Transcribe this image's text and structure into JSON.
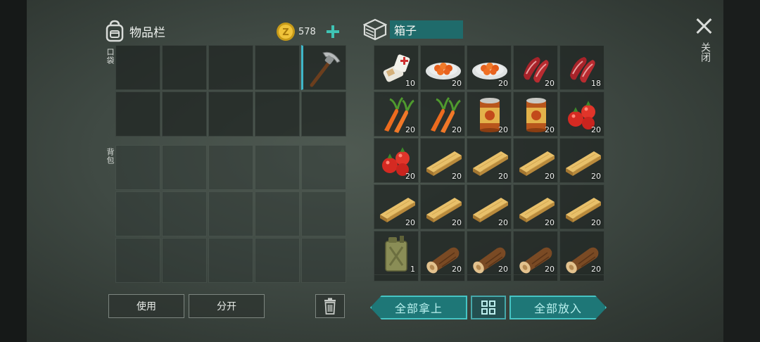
{
  "inventory": {
    "title": "物品栏",
    "coins": "578",
    "pocket_label": "口袋",
    "backpack_label": "背包",
    "use_label": "使用",
    "split_label": "分开",
    "pocket_slot_1_item": "pickaxe-icon"
  },
  "box": {
    "name": "箱子",
    "take_all_label": "全部拿上",
    "put_all_label": "全部放入",
    "slots": [
      {
        "item": "bandage",
        "count": "10"
      },
      {
        "item": "carrot-dish",
        "count": "20"
      },
      {
        "item": "carrot-dish",
        "count": "20"
      },
      {
        "item": "raw-meat",
        "count": "20"
      },
      {
        "item": "raw-meat",
        "count": "18"
      },
      {
        "item": "carrot",
        "count": "20"
      },
      {
        "item": "carrot",
        "count": "20"
      },
      {
        "item": "canned-food",
        "count": "20"
      },
      {
        "item": "canned-food",
        "count": "20"
      },
      {
        "item": "tomato",
        "count": "20"
      },
      {
        "item": "tomato",
        "count": "20"
      },
      {
        "item": "plank",
        "count": "20"
      },
      {
        "item": "plank",
        "count": "20"
      },
      {
        "item": "plank",
        "count": "20"
      },
      {
        "item": "plank",
        "count": "20"
      },
      {
        "item": "plank",
        "count": "20"
      },
      {
        "item": "plank",
        "count": "20"
      },
      {
        "item": "plank",
        "count": "20"
      },
      {
        "item": "plank",
        "count": "20"
      },
      {
        "item": "plank",
        "count": "20"
      },
      {
        "item": "jerry-can",
        "count": "1"
      },
      {
        "item": "log",
        "count": "20"
      },
      {
        "item": "log",
        "count": "20"
      },
      {
        "item": "log",
        "count": "20"
      },
      {
        "item": "log",
        "count": "20"
      }
    ]
  },
  "close_label": "关闭",
  "colors": {
    "accent": "#3fc4b4",
    "button_teal": "#1e7777"
  }
}
